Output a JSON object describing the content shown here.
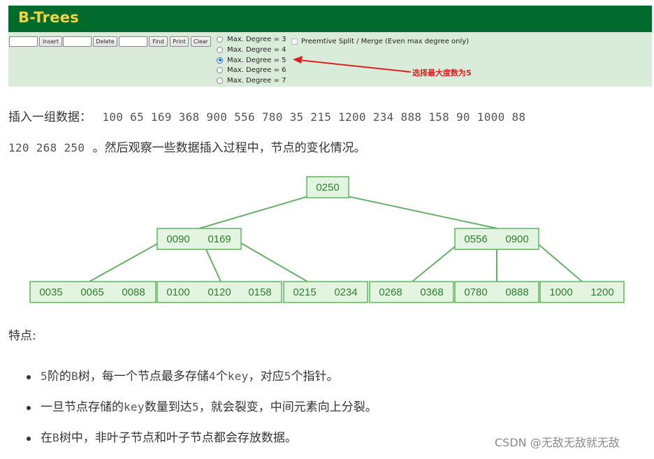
{
  "app": {
    "title": "B-Trees"
  },
  "toolbar": {
    "insert_label": "Insert",
    "delete_label": "Delete",
    "find_label": "Find",
    "print_label": "Print",
    "clear_label": "Clear",
    "degree_options": [
      "Max. Degree = 3",
      "Max. Degree = 4",
      "Max. Degree = 5",
      "Max. Degree = 6",
      "Max. Degree = 7"
    ],
    "selected_degree": "Max. Degree = 5",
    "preemptive_label": "Preemtive Split / Merge (Even max degree only)",
    "annotation": "选择最大度数为5"
  },
  "intro": {
    "label": "插入一组数据：",
    "numbers_line1": "100 65 169 368 900 556 780 35 215 1200 234 888 158 90 1000 88",
    "numbers_line2": "120 268 250",
    "suffix": "。然后观察一些数据插入过程中，节点的变化情况。"
  },
  "tree": {
    "root": [
      "0250"
    ],
    "level1": [
      [
        "0090",
        "0169"
      ],
      [
        "0556",
        "0900"
      ]
    ],
    "leaves": [
      [
        "0035",
        "0065",
        "0088"
      ],
      [
        "0100",
        "0120",
        "0158"
      ],
      [
        "0215",
        "0234"
      ],
      [
        "0268",
        "0368"
      ],
      [
        "0780",
        "0888"
      ],
      [
        "1000",
        "1200"
      ]
    ]
  },
  "features": {
    "heading": "特点:",
    "items": [
      [
        "5",
        "阶的",
        "B",
        "树，每一个节点最多存储",
        "4",
        "个",
        "key",
        "，对应",
        "5",
        "个指针。"
      ],
      [
        "一旦节点存储的",
        "key",
        "数量到达",
        "5",
        "，就会裂变，中间元素向上分裂。"
      ],
      [
        "在",
        "B",
        "树中，非叶子节点和叶子节点都会存放数据。"
      ]
    ]
  },
  "watermark": "CSDN @无敌无敌就无敌",
  "colors": {
    "header": "#006b2d",
    "title": "#f5d33a",
    "toolbar": "#d9ecd9",
    "node_fill": "#e3f5e0",
    "node_stroke": "#5fb55f",
    "key_text": "#2f7d2f",
    "annotation": "#e02020"
  }
}
